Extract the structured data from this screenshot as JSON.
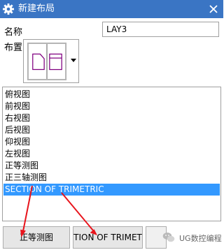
{
  "window": {
    "title": "新建布局"
  },
  "form": {
    "name_label": "名称",
    "name_value": "LAY3",
    "layout_label": "布置"
  },
  "view_list": {
    "items": [
      "俯视图",
      "前视图",
      "右视图",
      "后视图",
      "仰视图",
      "左视图",
      "正等测图",
      "正三轴测图",
      "SECTION OF TRIMETRIC"
    ],
    "selected_index": 8
  },
  "buttons": {
    "btn1_label": "正等测图",
    "btn2_label": "TION OF TRIMET"
  },
  "watermark": {
    "text": "UG数控编程"
  },
  "colors": {
    "titlebar": "#3a75c4",
    "selection": "#3399ff",
    "annotation_arrow": "#e8141c",
    "layout_preview_line": "#800080"
  },
  "icons": {
    "title_icon": "gear-icon",
    "close": "close-icon",
    "dropdown": "triangle-down-icon",
    "watermark": "wechat-icon"
  }
}
